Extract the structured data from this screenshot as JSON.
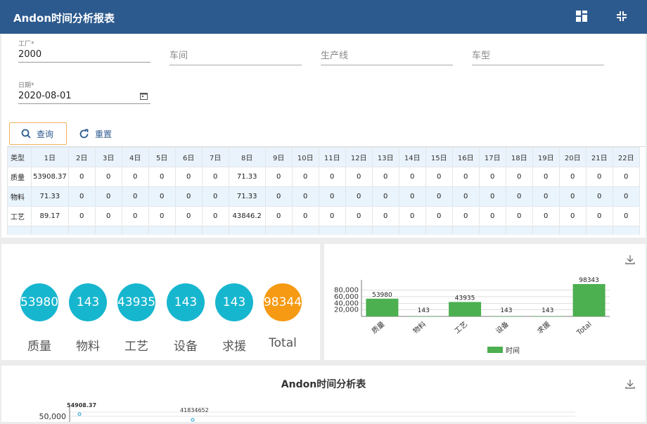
{
  "header": {
    "title": "Andon时间分析报表"
  },
  "filters": {
    "factory_label": "工厂*",
    "factory_value": "2000",
    "workshop_placeholder": "车间",
    "line_placeholder": "生产线",
    "model_placeholder": "车型",
    "date_label": "日期*",
    "date_value": "2020-08-01"
  },
  "buttons": {
    "search": "查询",
    "reset": "重置"
  },
  "table": {
    "headers": [
      "类型",
      "1日",
      "2日",
      "3日",
      "4日",
      "5日",
      "6日",
      "7日",
      "8日",
      "9日",
      "10日",
      "11日",
      "12日",
      "13日",
      "14日",
      "15日",
      "16日",
      "17日",
      "18日",
      "19日",
      "20日",
      "21日",
      "22日"
    ],
    "rows": [
      [
        "质量",
        "53908.37",
        "0",
        "0",
        "0",
        "0",
        "0",
        "0",
        "71.33",
        "0",
        "0",
        "0",
        "0",
        "0",
        "0",
        "0",
        "0",
        "0",
        "0",
        "0",
        "0",
        "0",
        "0"
      ],
      [
        "物料",
        "71.33",
        "0",
        "0",
        "0",
        "0",
        "0",
        "0",
        "71.33",
        "0",
        "0",
        "0",
        "0",
        "0",
        "0",
        "0",
        "0",
        "0",
        "0",
        "0",
        "0",
        "0",
        "0"
      ],
      [
        "工艺",
        "89.17",
        "0",
        "0",
        "0",
        "0",
        "0",
        "0",
        "43846.2",
        "0",
        "0",
        "0",
        "0",
        "0",
        "0",
        "0",
        "0",
        "0",
        "0",
        "0",
        "0",
        "0",
        "0"
      ]
    ]
  },
  "summary": [
    {
      "label": "质量",
      "value": "53980",
      "color": "#17b6cf"
    },
    {
      "label": "物料",
      "value": "143",
      "color": "#17b6cf"
    },
    {
      "label": "工艺",
      "value": "43935",
      "color": "#17b6cf"
    },
    {
      "label": "设备",
      "value": "143",
      "color": "#17b6cf"
    },
    {
      "label": "求援",
      "value": "143",
      "color": "#17b6cf"
    },
    {
      "label": "Total",
      "value": "98344",
      "color": "#f59a12"
    }
  ],
  "bottom": {
    "title": "Andon时间分析表"
  },
  "colors": {
    "header": "#2d5a8e",
    "bar": "#4caf50",
    "line": "#1a9fd6"
  },
  "icons": [
    "layout-icon",
    "collapse-icon",
    "search-icon",
    "refresh-icon",
    "calendar-icon",
    "download-icon"
  ],
  "chart_data": [
    {
      "type": "bar",
      "categories": [
        "质量",
        "物料",
        "工艺",
        "设备",
        "求援",
        "Total"
      ],
      "series": [
        {
          "name": "时间",
          "values": [
            53980,
            143,
            43935,
            143,
            143,
            98343
          ]
        }
      ],
      "yticks": [
        "20,000",
        "40,000",
        "60,000",
        "80,000"
      ],
      "ylim": [
        0,
        98343
      ],
      "legend": "bottom"
    },
    {
      "type": "line",
      "title": "Andon时间分析表",
      "yticks": [
        "50,000"
      ],
      "annotations": [
        "54908.37",
        "41834652"
      ]
    }
  ]
}
